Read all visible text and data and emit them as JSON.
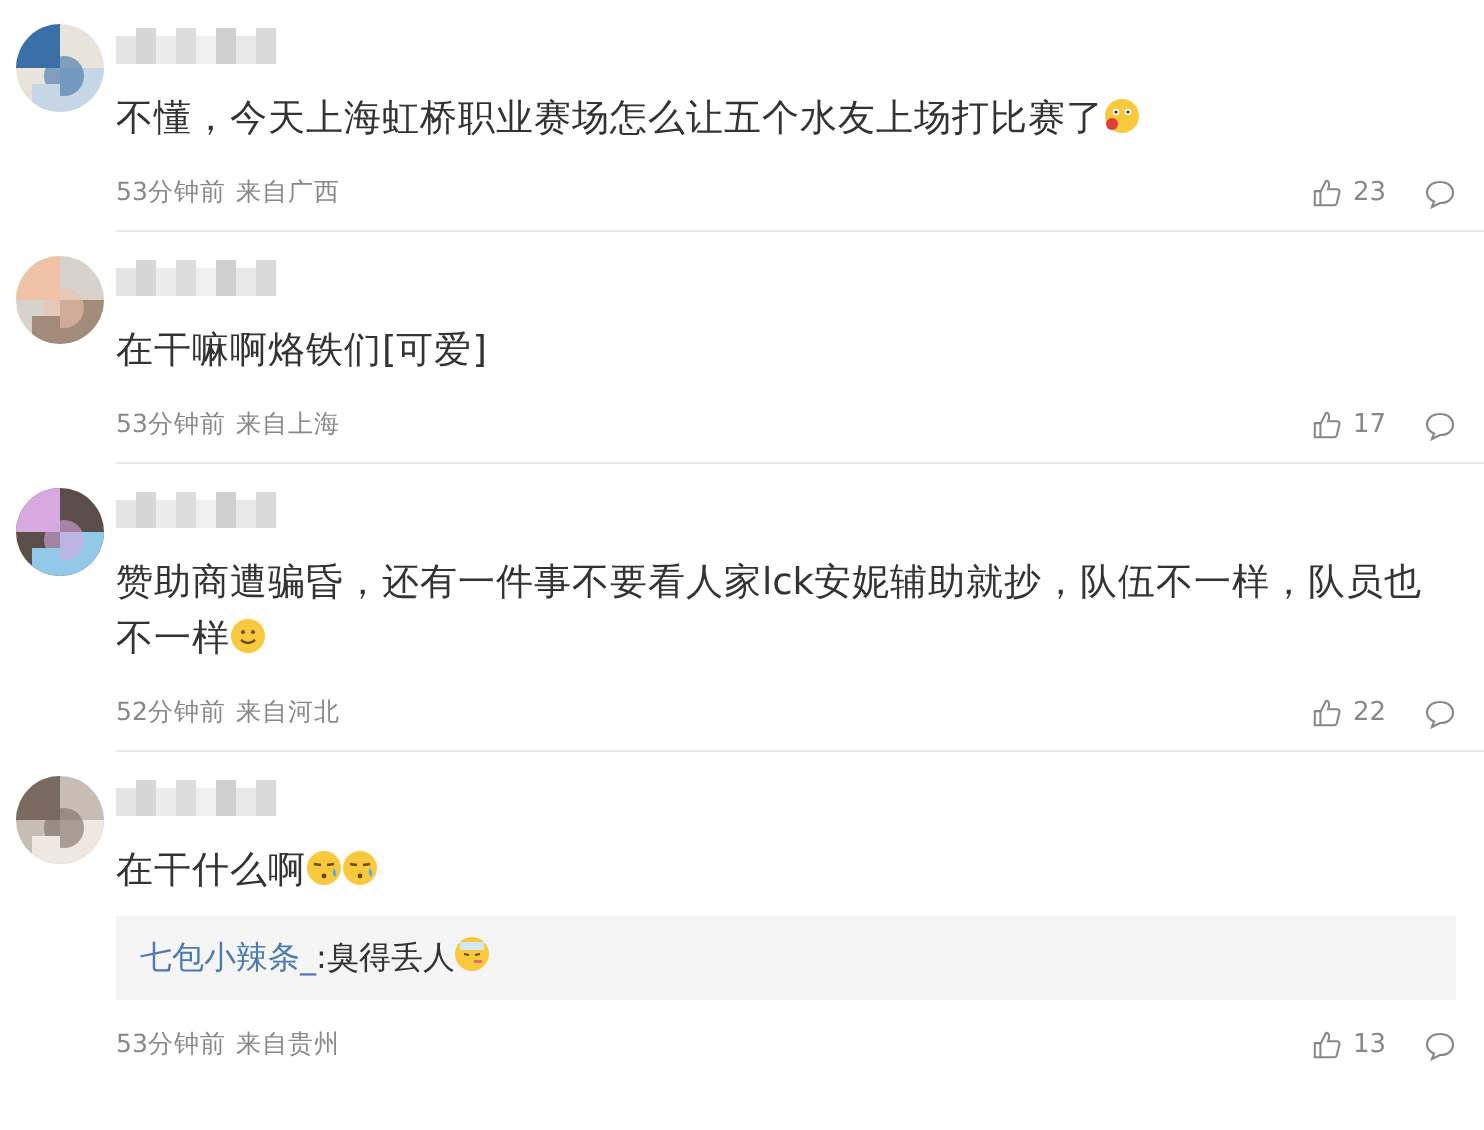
{
  "comments": [
    {
      "text": "不懂，今天上海虹桥职业赛场怎么让五个水友上场打比赛了",
      "emojis": [
        {
          "kind": "blush"
        }
      ],
      "time": "53分钟前",
      "location": "来自广西",
      "likes": "23",
      "avatar": {
        "kind": "picture"
      }
    },
    {
      "text": "在干嘛啊烙铁们[可爱]",
      "time": "53分钟前",
      "location": "来自上海",
      "likes": "17",
      "avatar": {
        "kind": "picture"
      }
    },
    {
      "text": "赞助商遭骗昏，还有一件事不要看人家lck安妮辅助就抄，队伍不一样，队员也不一样",
      "emojis": [
        {
          "kind": "smile"
        }
      ],
      "time": "52分钟前",
      "location": "来自河北",
      "likes": "22",
      "avatar": {
        "kind": "picture"
      }
    },
    {
      "text": "在干什么啊",
      "emojis": [
        {
          "kind": "tear"
        },
        {
          "kind": "tear"
        }
      ],
      "reply": {
        "author": "七包小辣条_",
        "text": ":臭得丢人",
        "emojis": [
          {
            "kind": "sick"
          }
        ]
      },
      "time": "53分钟前",
      "location": "来自贵州",
      "likes": "13",
      "avatar": {
        "kind": "picture"
      }
    }
  ]
}
